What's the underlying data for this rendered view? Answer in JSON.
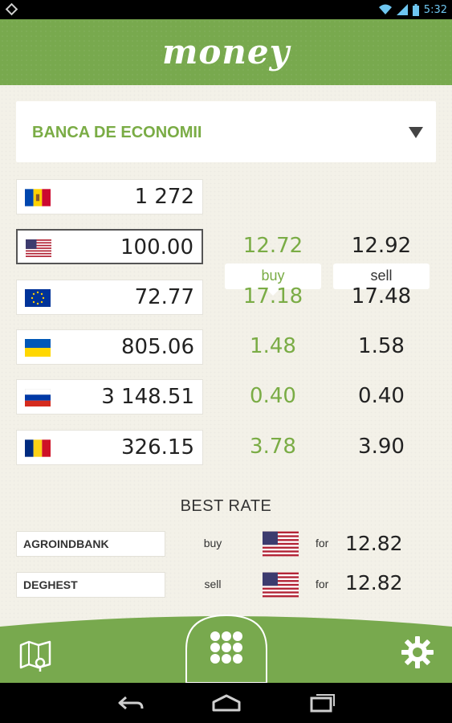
{
  "status_bar": {
    "time": "5:32"
  },
  "app": {
    "title": "money"
  },
  "bank_select": {
    "selected": "BANCA DE ECONOMII"
  },
  "columns": {
    "buy": "buy",
    "sell": "sell"
  },
  "base_row": {
    "currency": "MDL",
    "amount": "1 272"
  },
  "currencies": [
    {
      "code": "USD",
      "amount": "100.00",
      "buy": "12.72",
      "sell": "12.92"
    },
    {
      "code": "EUR",
      "amount": "72.77",
      "buy": "17.18",
      "sell": "17.48"
    },
    {
      "code": "UAH",
      "amount": "805.06",
      "buy": "1.48",
      "sell": "1.58"
    },
    {
      "code": "RUB",
      "amount": "3 148.51",
      "buy": "0.40",
      "sell": "0.40"
    },
    {
      "code": "RON",
      "amount": "326.15",
      "buy": "3.78",
      "sell": "3.90"
    }
  ],
  "best_rate": {
    "title": "BEST RATE",
    "rows": [
      {
        "bank": "AGROINDBANK",
        "kind": "buy",
        "currency": "USD",
        "for": "for",
        "value": "12.82"
      },
      {
        "bank": "DEGHEST",
        "kind": "sell",
        "currency": "USD",
        "for": "for",
        "value": "12.82"
      }
    ]
  },
  "colors": {
    "accent": "#78a94e",
    "accent_text": "#7aac45",
    "status_time": "#6ec6f0"
  },
  "icons": {
    "map": "map-pin-icon",
    "keypad": "keypad-icon",
    "settings": "gear-icon",
    "back": "back-icon",
    "home": "home-icon",
    "recents": "recents-icon"
  }
}
